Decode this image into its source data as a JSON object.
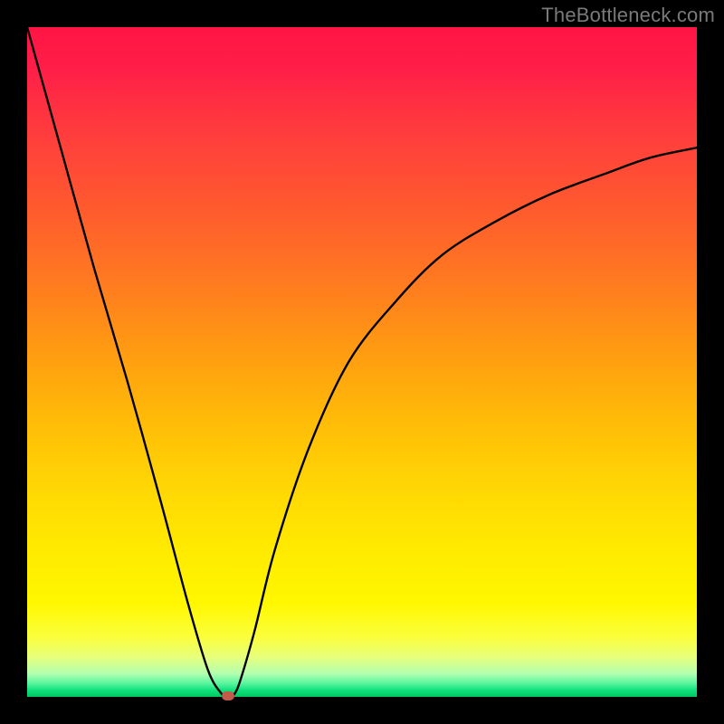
{
  "watermark": "TheBottleneck.com",
  "colors": {
    "frame": "#000000",
    "gradient_top": "#ff1444",
    "gradient_mid": "#ffd504",
    "gradient_bottom": "#00c860",
    "curve": "#000000",
    "marker": "#c35a4a"
  },
  "chart_data": {
    "type": "line",
    "title": "",
    "xlabel": "",
    "ylabel": "",
    "xlim": [
      0,
      100
    ],
    "ylim": [
      0,
      100
    ],
    "legend": false,
    "grid": false,
    "annotations": [
      "TheBottleneck.com"
    ],
    "series": [
      {
        "name": "bottleneck-curve",
        "x": [
          0,
          5,
          10,
          15,
          20,
          24,
          27,
          29,
          30,
          31,
          32,
          34,
          37,
          42,
          48,
          55,
          62,
          70,
          78,
          86,
          93,
          100
        ],
        "values": [
          100,
          82,
          64,
          47,
          29,
          14,
          4,
          0.5,
          0,
          0.5,
          3,
          10,
          22,
          37,
          50,
          59,
          66,
          71,
          75,
          78,
          80.5,
          82
        ]
      }
    ],
    "marker": {
      "x": 30,
      "y": 0
    }
  }
}
